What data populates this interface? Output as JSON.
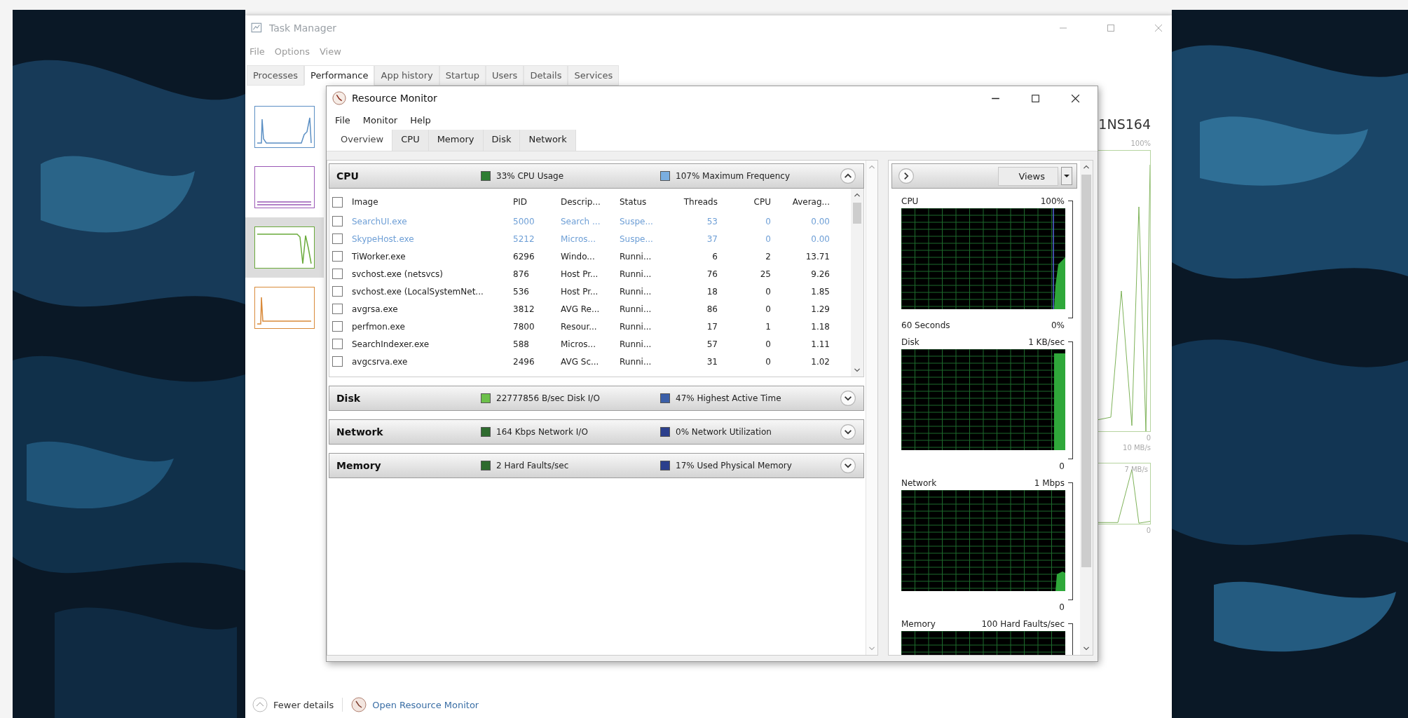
{
  "task_manager": {
    "title": "Task Manager",
    "menu": [
      "File",
      "Options",
      "View"
    ],
    "tabs": [
      {
        "label": "Processes",
        "selected": false
      },
      {
        "label": "Performance",
        "selected": true
      },
      {
        "label": "App history",
        "selected": false
      },
      {
        "label": "Startup",
        "selected": false
      },
      {
        "label": "Users",
        "selected": false
      },
      {
        "label": "Details",
        "selected": false
      },
      {
        "label": "Services",
        "selected": false
      }
    ],
    "thumbnails": [
      {
        "color": "#5b8fc4",
        "selected": false
      },
      {
        "color": "#9b59b6",
        "selected": false
      },
      {
        "color": "#6aaa3a",
        "selected": true
      },
      {
        "color": "#d98a3a",
        "selected": false
      }
    ],
    "device_name": "1NS164",
    "panels": [
      {
        "max": "100%",
        "min": "0"
      },
      {
        "max": "10 MB/s",
        "scale": "7 MB/s",
        "min": "0"
      }
    ],
    "fewer_details": "Fewer details",
    "open_link": "Open Resource Monitor"
  },
  "resource_monitor": {
    "title": "Resource Monitor",
    "menu": [
      "File",
      "Monitor",
      "Help"
    ],
    "tabs": [
      {
        "label": "Overview",
        "selected": true
      },
      {
        "label": "CPU",
        "selected": false
      },
      {
        "label": "Memory",
        "selected": false
      },
      {
        "label": "Disk",
        "selected": false
      },
      {
        "label": "Network",
        "selected": false
      }
    ],
    "sections": [
      {
        "title": "CPU",
        "expanded": true,
        "stats": [
          {
            "text": "33% CPU Usage",
            "color": "#2e7d32"
          },
          {
            "text": "107% Maximum Frequency",
            "color": "#7aaee0"
          }
        ]
      },
      {
        "title": "Disk",
        "expanded": false,
        "stats": [
          {
            "text": "22777856 B/sec Disk I/O",
            "color": "#6cc04a"
          },
          {
            "text": "47% Highest Active Time",
            "color": "#3b5fa8"
          }
        ]
      },
      {
        "title": "Network",
        "expanded": false,
        "stats": [
          {
            "text": "164 Kbps Network I/O",
            "color": "#2e6b2e"
          },
          {
            "text": "0% Network Utilization",
            "color": "#2b3f8c"
          }
        ]
      },
      {
        "title": "Memory",
        "expanded": false,
        "stats": [
          {
            "text": "2 Hard Faults/sec",
            "color": "#2e6b2e"
          },
          {
            "text": "17% Used Physical Memory",
            "color": "#2b3f8c"
          }
        ]
      }
    ],
    "table": {
      "header_checked": false,
      "columns": [
        "Image",
        "PID",
        "Descrip...",
        "Status",
        "Threads",
        "CPU",
        "Averag..."
      ],
      "rows": [
        {
          "checked": false,
          "suspended": true,
          "cells": [
            "SearchUI.exe",
            "5000",
            "Search ...",
            "Suspe...",
            "53",
            "0",
            "0.00"
          ]
        },
        {
          "checked": false,
          "suspended": true,
          "cells": [
            "SkypeHost.exe",
            "5212",
            "Micros...",
            "Suspe...",
            "37",
            "0",
            "0.00"
          ]
        },
        {
          "checked": false,
          "suspended": false,
          "cells": [
            "TiWorker.exe",
            "6296",
            "Windo...",
            "Runni...",
            "6",
            "2",
            "13.71"
          ]
        },
        {
          "checked": false,
          "suspended": false,
          "cells": [
            "svchost.exe (netsvcs)",
            "876",
            "Host Pr...",
            "Runni...",
            "76",
            "25",
            "9.26"
          ]
        },
        {
          "checked": false,
          "suspended": false,
          "cells": [
            "svchost.exe (LocalSystemNet...",
            "536",
            "Host Pr...",
            "Runni...",
            "18",
            "0",
            "1.85"
          ]
        },
        {
          "checked": false,
          "suspended": false,
          "cells": [
            "avgrsa.exe",
            "3812",
            "AVG Re...",
            "Runni...",
            "86",
            "0",
            "1.29"
          ]
        },
        {
          "checked": false,
          "suspended": false,
          "cells": [
            "perfmon.exe",
            "7800",
            "Resour...",
            "Runni...",
            "17",
            "1",
            "1.18"
          ]
        },
        {
          "checked": false,
          "suspended": false,
          "cells": [
            "SearchIndexer.exe",
            "588",
            "Micros...",
            "Runni...",
            "57",
            "0",
            "1.11"
          ]
        },
        {
          "checked": false,
          "suspended": false,
          "cells": [
            "avgcsrva.exe",
            "2496",
            "AVG Sc...",
            "Runni...",
            "31",
            "0",
            "1.02"
          ]
        }
      ]
    },
    "views_button": "Views",
    "graphs": [
      {
        "label": "CPU",
        "max": "100%",
        "time": "60 Seconds",
        "min": "0%"
      },
      {
        "label": "Disk",
        "max": "1 KB/sec",
        "min": "0"
      },
      {
        "label": "Network",
        "max": "1 Mbps",
        "min": "0"
      },
      {
        "label": "Memory",
        "max": "100 Hard Faults/sec"
      }
    ]
  }
}
